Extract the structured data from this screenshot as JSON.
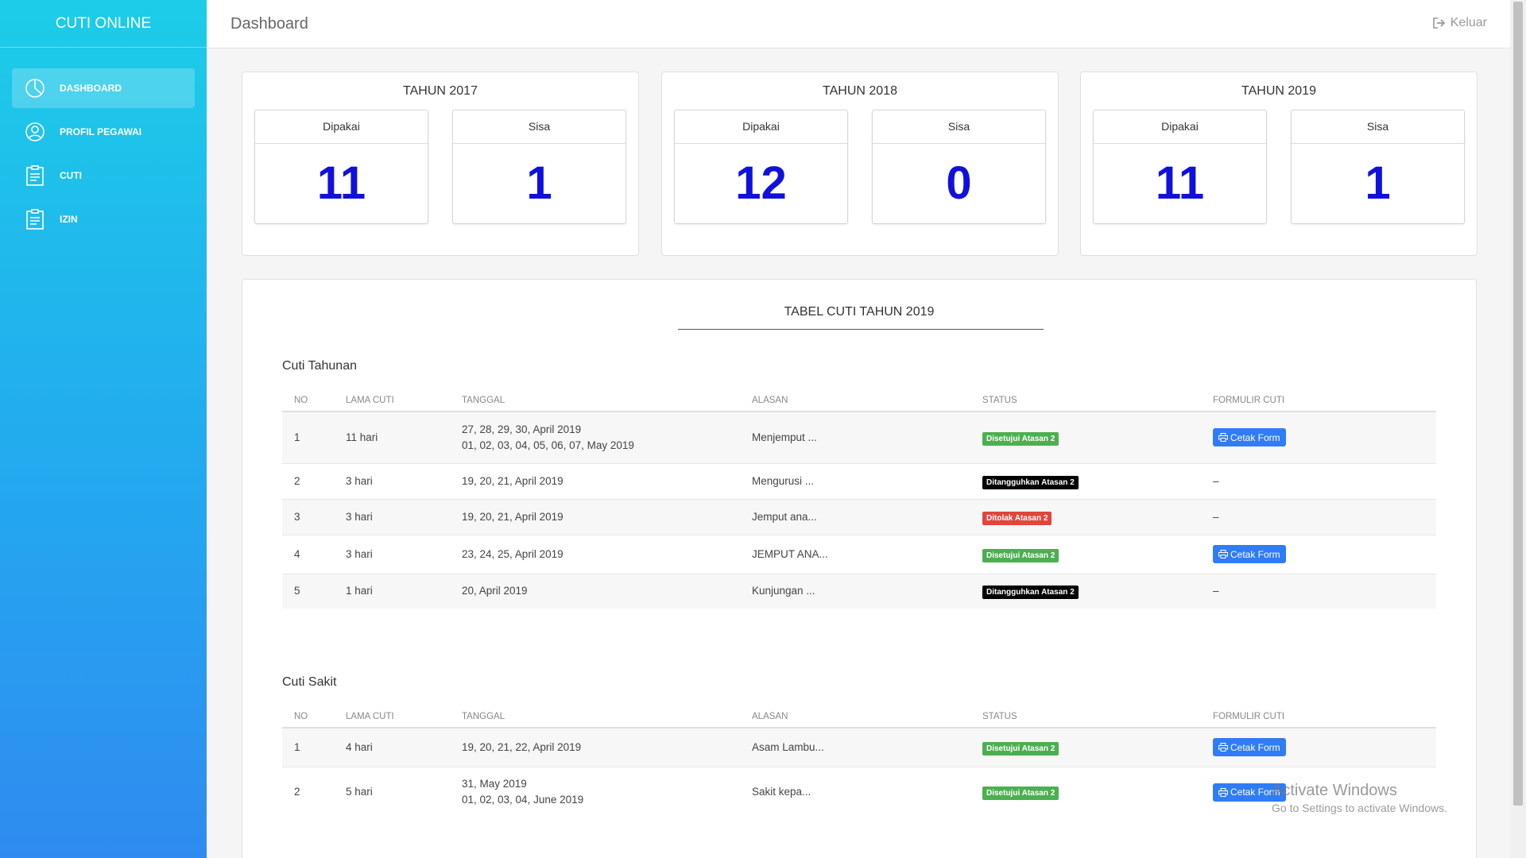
{
  "app": {
    "brand": "CUTI ONLINE"
  },
  "header": {
    "title": "Dashboard",
    "logout_label": "Keluar"
  },
  "sidebar": {
    "items": [
      {
        "label": "DASHBOARD",
        "icon": "dashboard-icon",
        "active": true
      },
      {
        "label": "PROFIL PEGAWAI",
        "icon": "user-icon"
      },
      {
        "label": "CUTI",
        "icon": "clipboard-icon"
      },
      {
        "label": "IZIN",
        "icon": "clipboard-icon"
      }
    ]
  },
  "years": [
    {
      "title": "TAHUN 2017",
      "used_label": "Dipakai",
      "used": "11",
      "remaining_label": "Sisa",
      "remaining": "1"
    },
    {
      "title": "TAHUN 2018",
      "used_label": "Dipakai",
      "used": "12",
      "remaining_label": "Sisa",
      "remaining": "0"
    },
    {
      "title": "TAHUN 2019",
      "used_label": "Dipakai",
      "used": "11",
      "remaining_label": "Sisa",
      "remaining": "1"
    }
  ],
  "table_card": {
    "title": "TABEL CUTI TAHUN 2019",
    "columns": [
      "NO",
      "LAMA CUTI",
      "TANGGAL",
      "ALASAN",
      "STATUS",
      "FORMULIR CUTI"
    ],
    "tahunan": {
      "title": "Cuti Tahunan",
      "rows": [
        {
          "no": "1",
          "lama": "11 hari",
          "tanggal_1": "27, 28, 29, 30, April 2019",
          "tanggal_2": "01, 02, 03, 04, 05, 06, 07, May 2019",
          "alasan": "Menjemput ...",
          "status": "Disetujui Atasan 2",
          "status_color": "#4caf50",
          "form": "Cetak Form"
        },
        {
          "no": "2",
          "lama": "3 hari",
          "tanggal_1": "19, 20, 21, April 2019",
          "alasan": "Mengurusi ...",
          "status": "Ditangguhkan Atasan 2",
          "status_color": "#000000",
          "form": "–"
        },
        {
          "no": "3",
          "lama": "3 hari",
          "tanggal_1": "19, 20, 21, April 2019",
          "alasan": "Jemput ana...",
          "status": "Ditolak Atasan 2",
          "status_color": "#e0463c",
          "form": "–"
        },
        {
          "no": "4",
          "lama": "3 hari",
          "tanggal_1": "23, 24, 25, April 2019",
          "alasan": "JEMPUT ANA...",
          "status": "Disetujui Atasan 2",
          "status_color": "#4caf50",
          "form": "Cetak Form"
        },
        {
          "no": "5",
          "lama": "1 hari",
          "tanggal_1": "20, April 2019",
          "alasan": "Kunjungan ...",
          "status": "Ditangguhkan Atasan 2",
          "status_color": "#000000",
          "form": "–"
        }
      ]
    },
    "sakit": {
      "title": "Cuti Sakit",
      "rows": [
        {
          "no": "1",
          "lama": "4 hari",
          "tanggal_1": "19, 20, 21, 22, April 2019",
          "alasan": "Asam Lambu...",
          "status": "Disetujui Atasan 2",
          "status_color": "#4caf50",
          "form": "Cetak Form"
        },
        {
          "no": "2",
          "lama": "5 hari",
          "tanggal_1": "31, May 2019",
          "tanggal_2": "01, 02, 03, 04, June 2019",
          "alasan": "Sakit kepa...",
          "status": "Disetujui Atasan 2",
          "status_color": "#4caf50",
          "form": "Cetak Form"
        }
      ]
    }
  },
  "watermark": {
    "title": "Activate Windows",
    "subtitle": "Go to Settings to activate Windows."
  }
}
